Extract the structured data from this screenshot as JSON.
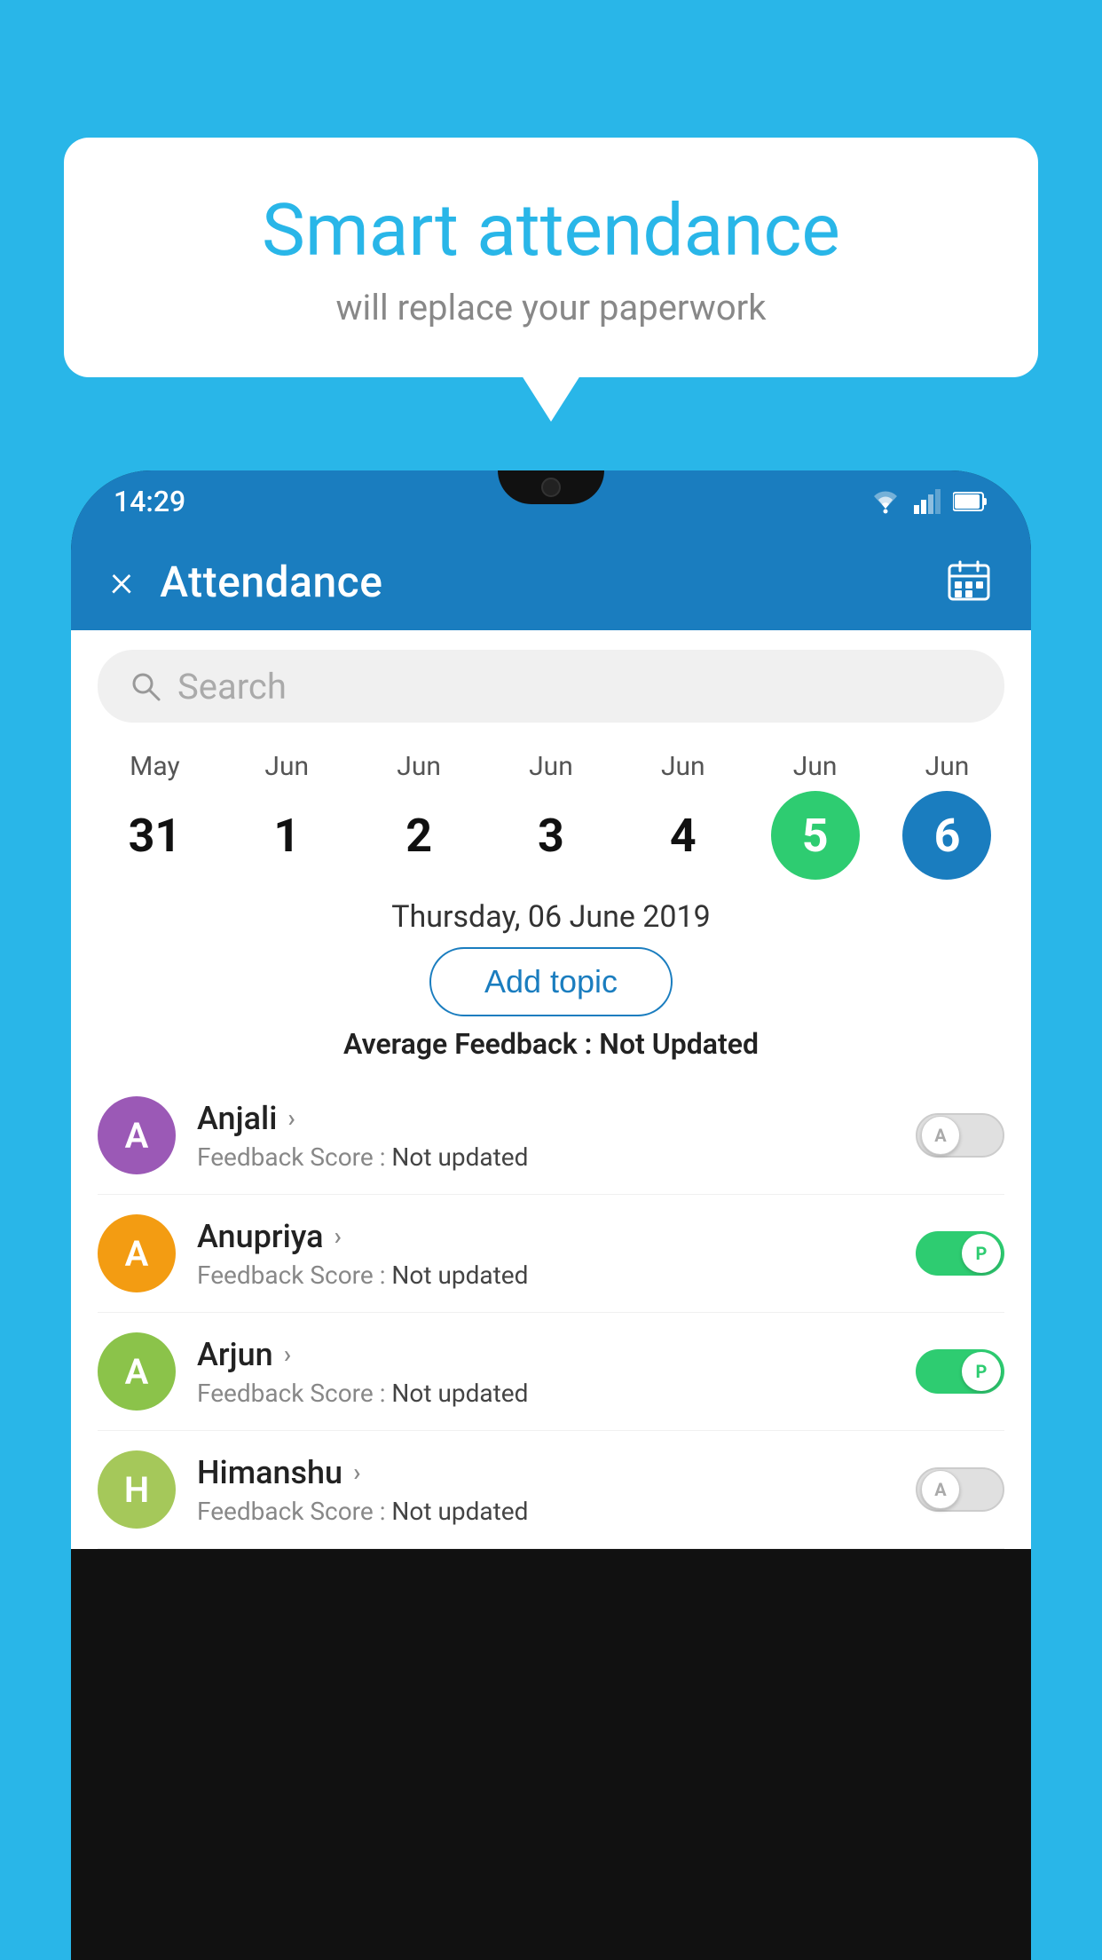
{
  "background_color": "#29b6e8",
  "bubble": {
    "title": "Smart attendance",
    "subtitle": "will replace your paperwork"
  },
  "status_bar": {
    "time": "14:29"
  },
  "header": {
    "title": "Attendance",
    "close_label": "×"
  },
  "search": {
    "placeholder": "Search"
  },
  "calendar": {
    "days": [
      {
        "month": "May",
        "date": "31",
        "state": "normal"
      },
      {
        "month": "Jun",
        "date": "1",
        "state": "normal"
      },
      {
        "month": "Jun",
        "date": "2",
        "state": "normal"
      },
      {
        "month": "Jun",
        "date": "3",
        "state": "normal"
      },
      {
        "month": "Jun",
        "date": "4",
        "state": "normal"
      },
      {
        "month": "Jun",
        "date": "5",
        "state": "today"
      },
      {
        "month": "Jun",
        "date": "6",
        "state": "selected"
      }
    ]
  },
  "selected_date": "Thursday, 06 June 2019",
  "add_topic_label": "Add topic",
  "avg_feedback_label": "Average Feedback :",
  "avg_feedback_value": "Not Updated",
  "students": [
    {
      "name": "Anjali",
      "avatar_letter": "A",
      "avatar_color": "#9b59b6",
      "feedback_label": "Feedback Score :",
      "feedback_value": "Not updated",
      "toggle_state": "off",
      "toggle_label": "A"
    },
    {
      "name": "Anupriya",
      "avatar_letter": "A",
      "avatar_color": "#f39c12",
      "feedback_label": "Feedback Score :",
      "feedback_value": "Not updated",
      "toggle_state": "on",
      "toggle_label": "P"
    },
    {
      "name": "Arjun",
      "avatar_letter": "A",
      "avatar_color": "#8bc34a",
      "feedback_label": "Feedback Score :",
      "feedback_value": "Not updated",
      "toggle_state": "on",
      "toggle_label": "P"
    },
    {
      "name": "Himanshu",
      "avatar_letter": "H",
      "avatar_color": "#a5c85a",
      "feedback_label": "Feedback Score :",
      "feedback_value": "Not updated",
      "toggle_state": "off",
      "toggle_label": "A"
    }
  ]
}
